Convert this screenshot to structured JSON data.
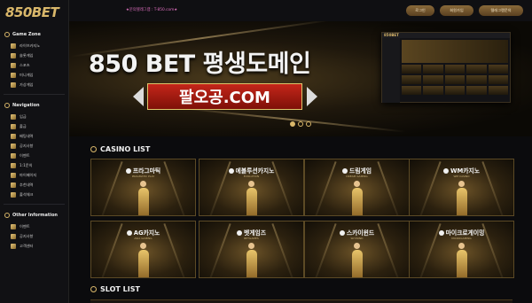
{
  "brand": {
    "logo": "850BET",
    "accent": "#d9b76a"
  },
  "topbar": {
    "notice": "★문의텔레그램 : T-850.com★",
    "buttons": [
      {
        "label": "로그인"
      },
      {
        "label": "회원가입"
      },
      {
        "label": "텔레그램문의"
      }
    ]
  },
  "sidebar": {
    "sections": [
      {
        "title": "Game Zone",
        "items": [
          "라이브카지노",
          "슬롯게임",
          "스포츠",
          "미니게임",
          "가상게임"
        ]
      },
      {
        "title": "Navigation",
        "items": [
          "입금",
          "출금",
          "배팅내역",
          "공지사항",
          "이벤트",
          "1:1문의",
          "마이페이지",
          "추천내역",
          "출석체크"
        ]
      },
      {
        "title": "Other Information",
        "items": [
          "이벤트",
          "공지사항",
          "고객센터"
        ]
      }
    ]
  },
  "banner": {
    "title": "850 BET 평생도메인",
    "domain": "팔오공.COM",
    "mockup_logo": "850BET"
  },
  "casino": {
    "title": "CASINO LIST",
    "games": [
      {
        "name": "프라그마틱",
        "sub": "PRAGMATIC PLAY"
      },
      {
        "name": "에볼루션카지노",
        "sub": "EVOLUTION"
      },
      {
        "name": "드림게임",
        "sub": "DREAM GAMING"
      },
      {
        "name": "WM카지노",
        "sub": "WM CASINO"
      },
      {
        "name": "AG카지노",
        "sub": "ASIA GAMING"
      },
      {
        "name": "벳게임즈",
        "sub": "BETGAMES"
      },
      {
        "name": "스카이윈드",
        "sub": "SKYWIND"
      },
      {
        "name": "마이크로게이밍",
        "sub": "MICROGAMING"
      }
    ]
  },
  "slot": {
    "title": "SLOT LIST"
  }
}
